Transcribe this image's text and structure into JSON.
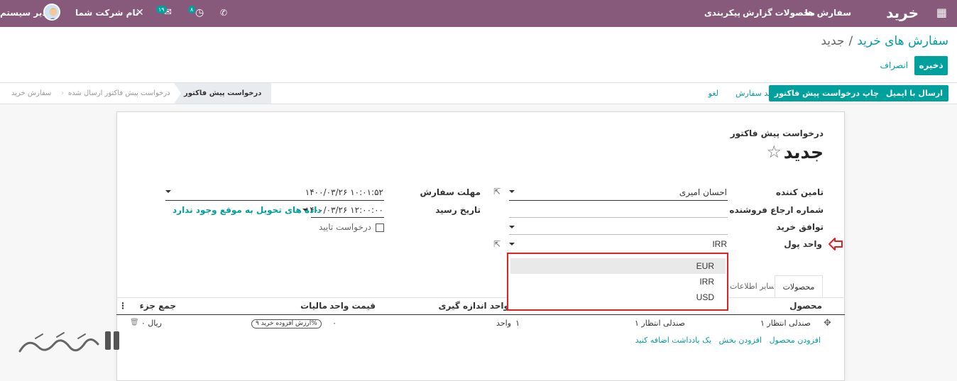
{
  "topbar": {
    "brand": "خرید",
    "menu": [
      "سفارش ها",
      "محصولات",
      "گزارش",
      "پیکربندی"
    ],
    "company": "نام شرکت شما",
    "user": "مدیر سیستم",
    "activity_count": "۸",
    "messages_count": "۱۹",
    "bar_color": "#875a7b"
  },
  "breadcrumb": {
    "parent": "سفارش های خرید",
    "separator": "/",
    "current": "جدید"
  },
  "actions": {
    "save": "ذخیره",
    "discard": "انصراف"
  },
  "statusbar": {
    "buttons": [
      "ارسال با ایمیل",
      "چاپ درخواست پیش فاکتور",
      "تایید سفارش",
      "لغو"
    ],
    "stages": [
      "درخواست پیش فاکتور",
      "درخواست پیش فاکتور ارسال شده",
      "سفارش خرید"
    ]
  },
  "form": {
    "doc_type": "درخواست پیش فاکتور",
    "name": "جدید",
    "labels": {
      "vendor": "تامین کننده",
      "vendor_ref": "شماره ارجاع فروشنده",
      "agreement": "توافق خرید",
      "currency": "واحد پول",
      "order_deadline": "مهلت سفارش",
      "receipt_date": "تاریخ رسید"
    },
    "values": {
      "vendor": "احسان امیری",
      "currency": "IRR",
      "order_deadline": "۱۴۰۰/۰۳/۲۶ ۱۰:۰۱:۵۲",
      "receipt_date": "۱۴۰۰/۰۳/۲۶ ۱۲:۰۰:۰۰",
      "delivery_info": "داده های تحویل به موقع وجود ندارد",
      "ask_confirmation": "درخواست تایید"
    },
    "currency_options": [
      "EUR",
      "IRR",
      "USD"
    ]
  },
  "tabs": [
    "محصولات",
    "سایر اطلاعات"
  ],
  "lines_table": {
    "headers": [
      "محصول",
      "واحد اندازه گیری",
      "قیمت واحد",
      "مالیات",
      "جمع جزء"
    ],
    "row": {
      "product": "صندلی انتظار ۱",
      "description": "صندلی انتظار ۱",
      "quantity": "۱",
      "uom": "واحد",
      "price": "۰",
      "tax": "ارزش افزوده خرید ۹%",
      "subtotal": "۰ ریال"
    },
    "add_links": [
      "افزودن محصول",
      "افزودن بخش",
      "یک یادداشت اضافه کنید"
    ]
  },
  "accent_color": "#00a09d",
  "highlight_color": "#e02222"
}
